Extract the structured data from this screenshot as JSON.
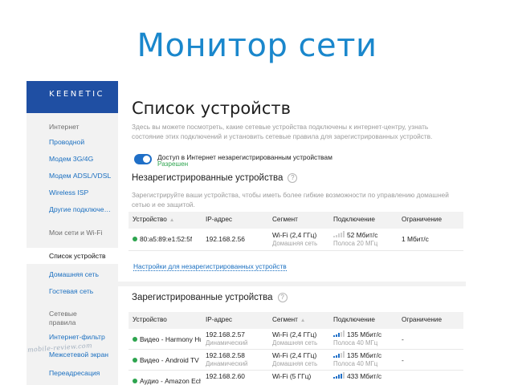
{
  "slide_title": "Монитор сети",
  "brand": {
    "logo": "KEENETIC",
    "accent": "#1f4fa3",
    "link": "#1a6fc0",
    "ok": "#2da44e"
  },
  "sidebar": {
    "group_internet": "Интернет",
    "items_internet": [
      {
        "label": "Проводной"
      },
      {
        "label": "Модем 3G/4G"
      },
      {
        "label": "Модем ADSL/VDSL"
      },
      {
        "label": "Wireless ISP"
      },
      {
        "label": "Другие подключе…"
      }
    ],
    "group_network": "Мои сети и Wi-Fi",
    "items_network": [
      {
        "label": "Список устройств",
        "active": true
      },
      {
        "label": "Домашняя сеть"
      },
      {
        "label": "Гостевая сеть"
      }
    ],
    "group_rules": "Сетевые правила",
    "items_rules": [
      {
        "label": "Интернет-фильтр"
      },
      {
        "label": "Межсетевой экран"
      },
      {
        "label": "Переадресация"
      }
    ]
  },
  "page": {
    "title": "Список устройств",
    "description": "Здесь вы можете посмотреть, какие сетевые устройства подключены к интернет-центру, узнать состояние этих подключений и установить сетевые правила для зарегистрированных устройств.",
    "toggle_label": "Доступ в Интернет незарегистрированным устройствам",
    "toggle_status": "Разрешен",
    "toggle_on": true
  },
  "unregistered": {
    "title": "Незарегистрированные устройства",
    "help": "?",
    "hint": "Зарегистрируйте ваши устройства, чтобы иметь более гибкие возможности по управлению домашней сетью и ее защитой.",
    "columns": [
      "Устройство",
      "IP-адрес",
      "Сегмент",
      "Подключение",
      "Ограничение"
    ],
    "rows": [
      {
        "device": "80:a5:89:e1:52:5f",
        "ip": "192.168.2.56",
        "ip_sub": "",
        "segment": "Wi-Fi (2,4 ГГц)",
        "segment_sub": "Домашняя сеть",
        "speed": "52 Мбит/с",
        "band": "Полоса 20 МГц",
        "signal": 2,
        "limit": "1 Мбит/с"
      }
    ],
    "settings_link": "Настройки для незарегистрированных устройств"
  },
  "registered": {
    "title": "Зарегистрированные устройства",
    "help": "?",
    "columns": [
      "Устройство",
      "IP-адрес",
      "Сегмент",
      "Подключение",
      "Ограничение"
    ],
    "rows": [
      {
        "device": "Видео - Harmony Hub",
        "ip": "192.168.2.57",
        "ip_sub": "Динамический",
        "segment": "Wi-Fi (2,4 ГГц)",
        "segment_sub": "Домашняя сеть",
        "speed": "135 Мбит/с",
        "band": "Полоса 40 МГц",
        "signal": 3,
        "limit": "-"
      },
      {
        "device": "Видео - Android TV",
        "ip": "192.168.2.58",
        "ip_sub": "Динамический",
        "segment": "Wi-Fi (2,4 ГГц)",
        "segment_sub": "Домашняя сеть",
        "speed": "135 Мбит/с",
        "band": "Полоса 40 МГц",
        "signal": 3,
        "limit": "-"
      },
      {
        "device": "Аудио - Amazon Echo",
        "ip": "192.168.2.60",
        "ip_sub": "",
        "segment": "Wi-Fi (5 ГГц)",
        "segment_sub": "",
        "speed": "433 Мбит/с",
        "band": "",
        "signal": 4,
        "limit": ""
      }
    ]
  },
  "watermark": "mobile-review.com"
}
